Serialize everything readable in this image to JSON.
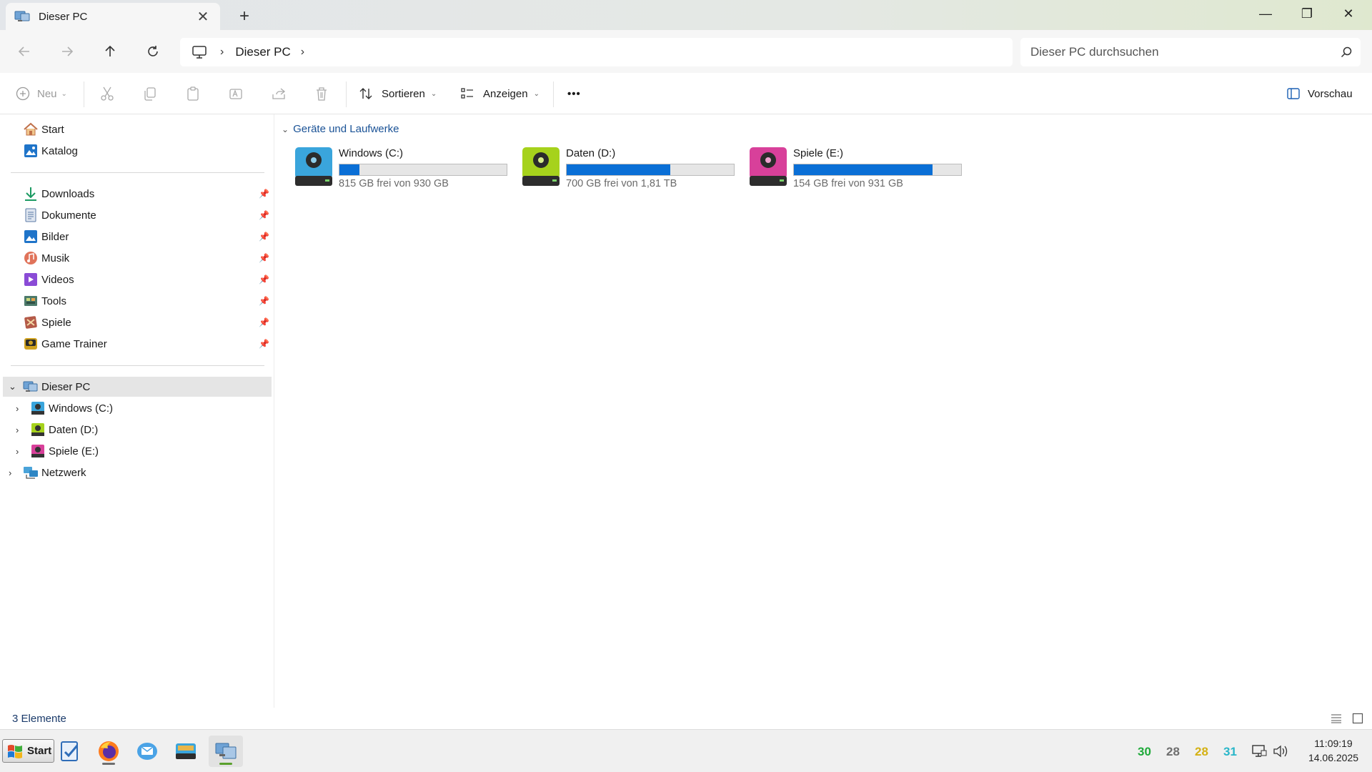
{
  "window": {
    "tab_title": "Dieser PC",
    "tab_close": "✕",
    "new_tab": "+",
    "minimize": "—",
    "maximize": "❐",
    "close": "✕"
  },
  "nav": {
    "breadcrumb": "Dieser PC",
    "sep": "›",
    "search_placeholder": "Dieser PC durchsuchen"
  },
  "toolbar": {
    "new_label": "Neu",
    "sort_label": "Sortieren",
    "view_label": "Anzeigen",
    "more_label": "•••",
    "preview_label": "Vorschau"
  },
  "sidebar": {
    "home": "Start",
    "gallery": "Katalog",
    "pinned": [
      {
        "label": "Downloads"
      },
      {
        "label": "Dokumente"
      },
      {
        "label": "Bilder"
      },
      {
        "label": "Musik"
      },
      {
        "label": "Videos"
      },
      {
        "label": "Tools"
      },
      {
        "label": "Spiele"
      },
      {
        "label": "Game Trainer"
      }
    ],
    "this_pc": "Dieser PC",
    "drives": [
      {
        "label": "Windows (C:)"
      },
      {
        "label": "Daten (D:)"
      },
      {
        "label": "Spiele (E:)"
      }
    ],
    "network": "Netzwerk"
  },
  "content": {
    "group_header": "Geräte und Laufwerke",
    "drives": [
      {
        "name": "Windows (C:)",
        "free_text": "815 GB frei von 930 GB",
        "used_fraction": 0.12,
        "color": "#3aa5dc"
      },
      {
        "name": "Daten (D:)",
        "free_text": "700 GB frei von 1,81 TB",
        "used_fraction": 0.62,
        "color": "#a6d21c"
      },
      {
        "name": "Spiele (E:)",
        "free_text": "154 GB frei von 931 GB",
        "used_fraction": 0.83,
        "color": "#d8409a"
      }
    ]
  },
  "status": {
    "item_count": "3 Elemente"
  },
  "taskbar": {
    "start_label": "Start",
    "temps": [
      {
        "value": "30",
        "color": "#1faa3a"
      },
      {
        "value": "28",
        "color": "#6e6e6e"
      },
      {
        "value": "28",
        "color": "#d4b114"
      },
      {
        "value": "31",
        "color": "#29b6c9"
      }
    ],
    "time": "11:09:19",
    "date": "14.06.2025"
  },
  "colors": {
    "accent": "#0a6fd6",
    "selected": "#e5e5e5"
  }
}
